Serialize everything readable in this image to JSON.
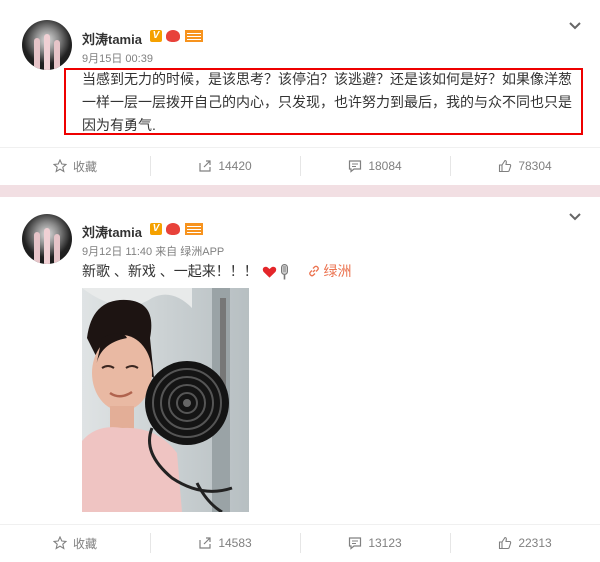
{
  "colors": {
    "accent": "#eb7350",
    "highlight_border": "#e00000",
    "background": "#f2dfe3"
  },
  "posts": [
    {
      "author": "刘涛tamia",
      "verified_badge": "V",
      "time": "9月15日 00:39",
      "source": "",
      "text": "当感到无力的时候，是该思考？该停泊？该逃避？还是该如何是好？如果像洋葱一样一层一层拨开自己的内心，只发现，也许努力到最后，我的与众不同也只是因为有勇气.",
      "actions": {
        "favorite": "收藏",
        "repost": "14420",
        "comment": "18084",
        "like": "78304"
      }
    },
    {
      "author": "刘涛tamia",
      "verified_badge": "V",
      "time": "9月12日 11:40",
      "source": "来自 绿洲APP",
      "text": "新歌 、新戏 、一起来！！！",
      "location": "绿洲",
      "actions": {
        "favorite": "收藏",
        "repost": "14583",
        "comment": "13123",
        "like": "22313"
      }
    }
  ],
  "icons": [
    "star-icon",
    "repost-icon",
    "comment-icon",
    "like-icon",
    "chevron-down-icon",
    "link-icon",
    "heart-icon",
    "microphone-icon"
  ]
}
